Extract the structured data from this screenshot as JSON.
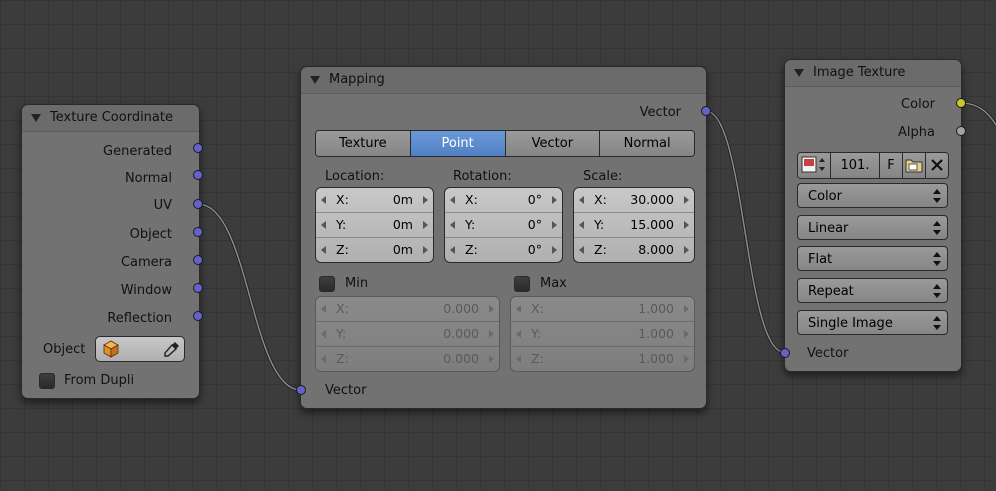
{
  "nodes": {
    "texture_coordinate": {
      "title": "Texture Coordinate",
      "outputs": [
        "Generated",
        "Normal",
        "UV",
        "Object",
        "Camera",
        "Window",
        "Reflection"
      ],
      "object_label": "Object",
      "from_dupli_label": "From Dupli"
    },
    "mapping": {
      "title": "Mapping",
      "output_label": "Vector",
      "input_label": "Vector",
      "tabs": [
        "Texture",
        "Point",
        "Vector",
        "Normal"
      ],
      "active_tab": "Point",
      "location": {
        "label": "Location:",
        "rows": [
          {
            "axis": "X:",
            "value": "0m"
          },
          {
            "axis": "Y:",
            "value": "0m"
          },
          {
            "axis": "Z:",
            "value": "0m"
          }
        ]
      },
      "rotation": {
        "label": "Rotation:",
        "rows": [
          {
            "axis": "X:",
            "value": "0°"
          },
          {
            "axis": "Y:",
            "value": "0°"
          },
          {
            "axis": "Z:",
            "value": "0°"
          }
        ]
      },
      "scale": {
        "label": "Scale:",
        "rows": [
          {
            "axis": "X:",
            "value": "30.000"
          },
          {
            "axis": "Y:",
            "value": "15.000"
          },
          {
            "axis": "Z:",
            "value": "8.000"
          }
        ]
      },
      "min": {
        "label": "Min",
        "rows": [
          {
            "axis": "X:",
            "value": "0.000"
          },
          {
            "axis": "Y:",
            "value": "0.000"
          },
          {
            "axis": "Z:",
            "value": "0.000"
          }
        ]
      },
      "max": {
        "label": "Max",
        "rows": [
          {
            "axis": "X:",
            "value": "1.000"
          },
          {
            "axis": "Y:",
            "value": "1.000"
          },
          {
            "axis": "Z:",
            "value": "1.000"
          }
        ]
      }
    },
    "image_texture": {
      "title": "Image Texture",
      "outputs": [
        "Color",
        "Alpha"
      ],
      "image_users": "101.",
      "fake_user": "F",
      "color_mode": "Color",
      "interpolation": "Linear",
      "projection": "Flat",
      "extension": "Repeat",
      "source": "Single Image",
      "input_label": "Vector"
    }
  },
  "colors": {
    "vector_socket": "#6363c7",
    "color_socket": "#c7c729",
    "alpha_socket": "#a1a1a1",
    "active_tab": "#5a8acc"
  }
}
